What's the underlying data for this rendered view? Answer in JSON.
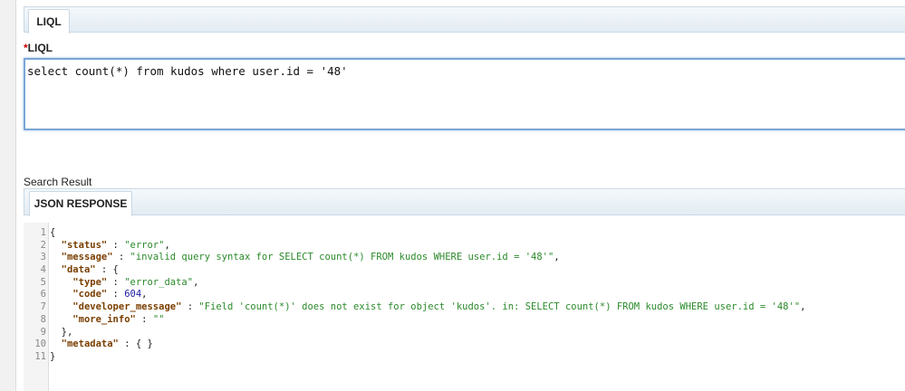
{
  "tabs": {
    "liql_tab": "LIQL",
    "json_tab": "JSON RESPONSE"
  },
  "query": {
    "required_mark": "*",
    "label": "LIQL",
    "value": "select count(*) from kudos where user.id = '48'"
  },
  "result": {
    "label": "Search Result"
  },
  "colors": {
    "key": "#7a3e00",
    "string": "#2b8a2b",
    "number": "#1a1aa6",
    "focus_border": "#7aa5d6"
  },
  "json_lines": [
    {
      "n": "1",
      "parts": [
        {
          "t": "p",
          "v": "{"
        }
      ]
    },
    {
      "n": "2",
      "parts": [
        {
          "t": "p",
          "v": "  "
        },
        {
          "t": "k",
          "v": "\"status\""
        },
        {
          "t": "p",
          "v": " : "
        },
        {
          "t": "s",
          "v": "\"error\""
        },
        {
          "t": "p",
          "v": ","
        }
      ]
    },
    {
      "n": "3",
      "parts": [
        {
          "t": "p",
          "v": "  "
        },
        {
          "t": "k",
          "v": "\"message\""
        },
        {
          "t": "p",
          "v": " : "
        },
        {
          "t": "s",
          "v": "\"invalid query syntax for SELECT count(*) FROM kudos WHERE user.id = '48'\""
        },
        {
          "t": "p",
          "v": ","
        }
      ]
    },
    {
      "n": "4",
      "parts": [
        {
          "t": "p",
          "v": "  "
        },
        {
          "t": "k",
          "v": "\"data\""
        },
        {
          "t": "p",
          "v": " : {"
        }
      ]
    },
    {
      "n": "5",
      "parts": [
        {
          "t": "p",
          "v": "    "
        },
        {
          "t": "k",
          "v": "\"type\""
        },
        {
          "t": "p",
          "v": " : "
        },
        {
          "t": "s",
          "v": "\"error_data\""
        },
        {
          "t": "p",
          "v": ","
        }
      ]
    },
    {
      "n": "6",
      "parts": [
        {
          "t": "p",
          "v": "    "
        },
        {
          "t": "k",
          "v": "\"code\""
        },
        {
          "t": "p",
          "v": " : "
        },
        {
          "t": "n",
          "v": "604"
        },
        {
          "t": "p",
          "v": ","
        }
      ]
    },
    {
      "n": "7",
      "parts": [
        {
          "t": "p",
          "v": "    "
        },
        {
          "t": "k",
          "v": "\"developer_message\""
        },
        {
          "t": "p",
          "v": " : "
        },
        {
          "t": "s",
          "v": "\"Field 'count(*)' does not exist for object 'kudos'. in: SELECT count(*) FROM kudos WHERE user.id = '48'\""
        },
        {
          "t": "p",
          "v": ","
        }
      ]
    },
    {
      "n": "8",
      "parts": [
        {
          "t": "p",
          "v": "    "
        },
        {
          "t": "k",
          "v": "\"more_info\""
        },
        {
          "t": "p",
          "v": " : "
        },
        {
          "t": "s",
          "v": "\"\""
        }
      ]
    },
    {
      "n": "9",
      "parts": [
        {
          "t": "p",
          "v": "  },"
        }
      ]
    },
    {
      "n": "10",
      "parts": [
        {
          "t": "p",
          "v": "  "
        },
        {
          "t": "k",
          "v": "\"metadata\""
        },
        {
          "t": "p",
          "v": " : { }"
        }
      ]
    },
    {
      "n": "11",
      "parts": [
        {
          "t": "p",
          "v": "}"
        }
      ]
    }
  ]
}
